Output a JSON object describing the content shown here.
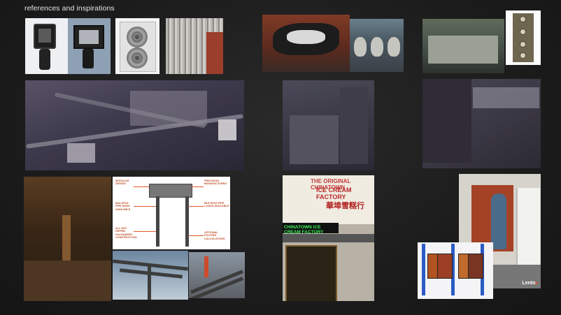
{
  "title": "references and inspirations",
  "images": {
    "flood_lights": "flood lights",
    "ac_unit": "air conditioning unit",
    "corrugated": "corrugated metal",
    "graffiti_skull": "graffiti skull",
    "graffiti_masks": "graffiti masks",
    "tarp": "tarp",
    "canvas": "canvas",
    "render_pipes": "render pipes",
    "render_alley_door": "render alley door",
    "render_shelter": "render shelter",
    "alley_photo": "alley photo",
    "truss_photo_1": "truss photo 1",
    "truss_photo_2": "truss photo 2",
    "shop_photo": "shop photo",
    "kiosk_photo": "kiosk photo",
    "booth_photo": "booth photo"
  },
  "infographic": {
    "modular_design": "MODULAR DESIGN",
    "precision_manufactured": "PRECISION MANUFACTURED",
    "multiple_pipe_sizes": "MULTIPLE PIPE SIZES AVAILABLE",
    "multiple_pipe_loads": "MULTIPLE PIPE LOADS AVAILABLE",
    "galvanized": "ALL HOT DIPPED GALVANIZED CONSTRUCTION",
    "footing": "OPTIONAL FOOTING CALCULATIONS"
  },
  "shop_sign": {
    "line1": "THE ORIGINAL CHINATOWN",
    "line2": "ICE CREAM FACTORY",
    "line3": "華埠雪糕行",
    "neon": "CHINATOWN ICE CREAM FACTORY"
  },
  "watermark": {
    "brand": "Lento",
    "accent": "▸"
  },
  "colors": {
    "background": "#1c1c1c",
    "accent": "#e8542b"
  }
}
